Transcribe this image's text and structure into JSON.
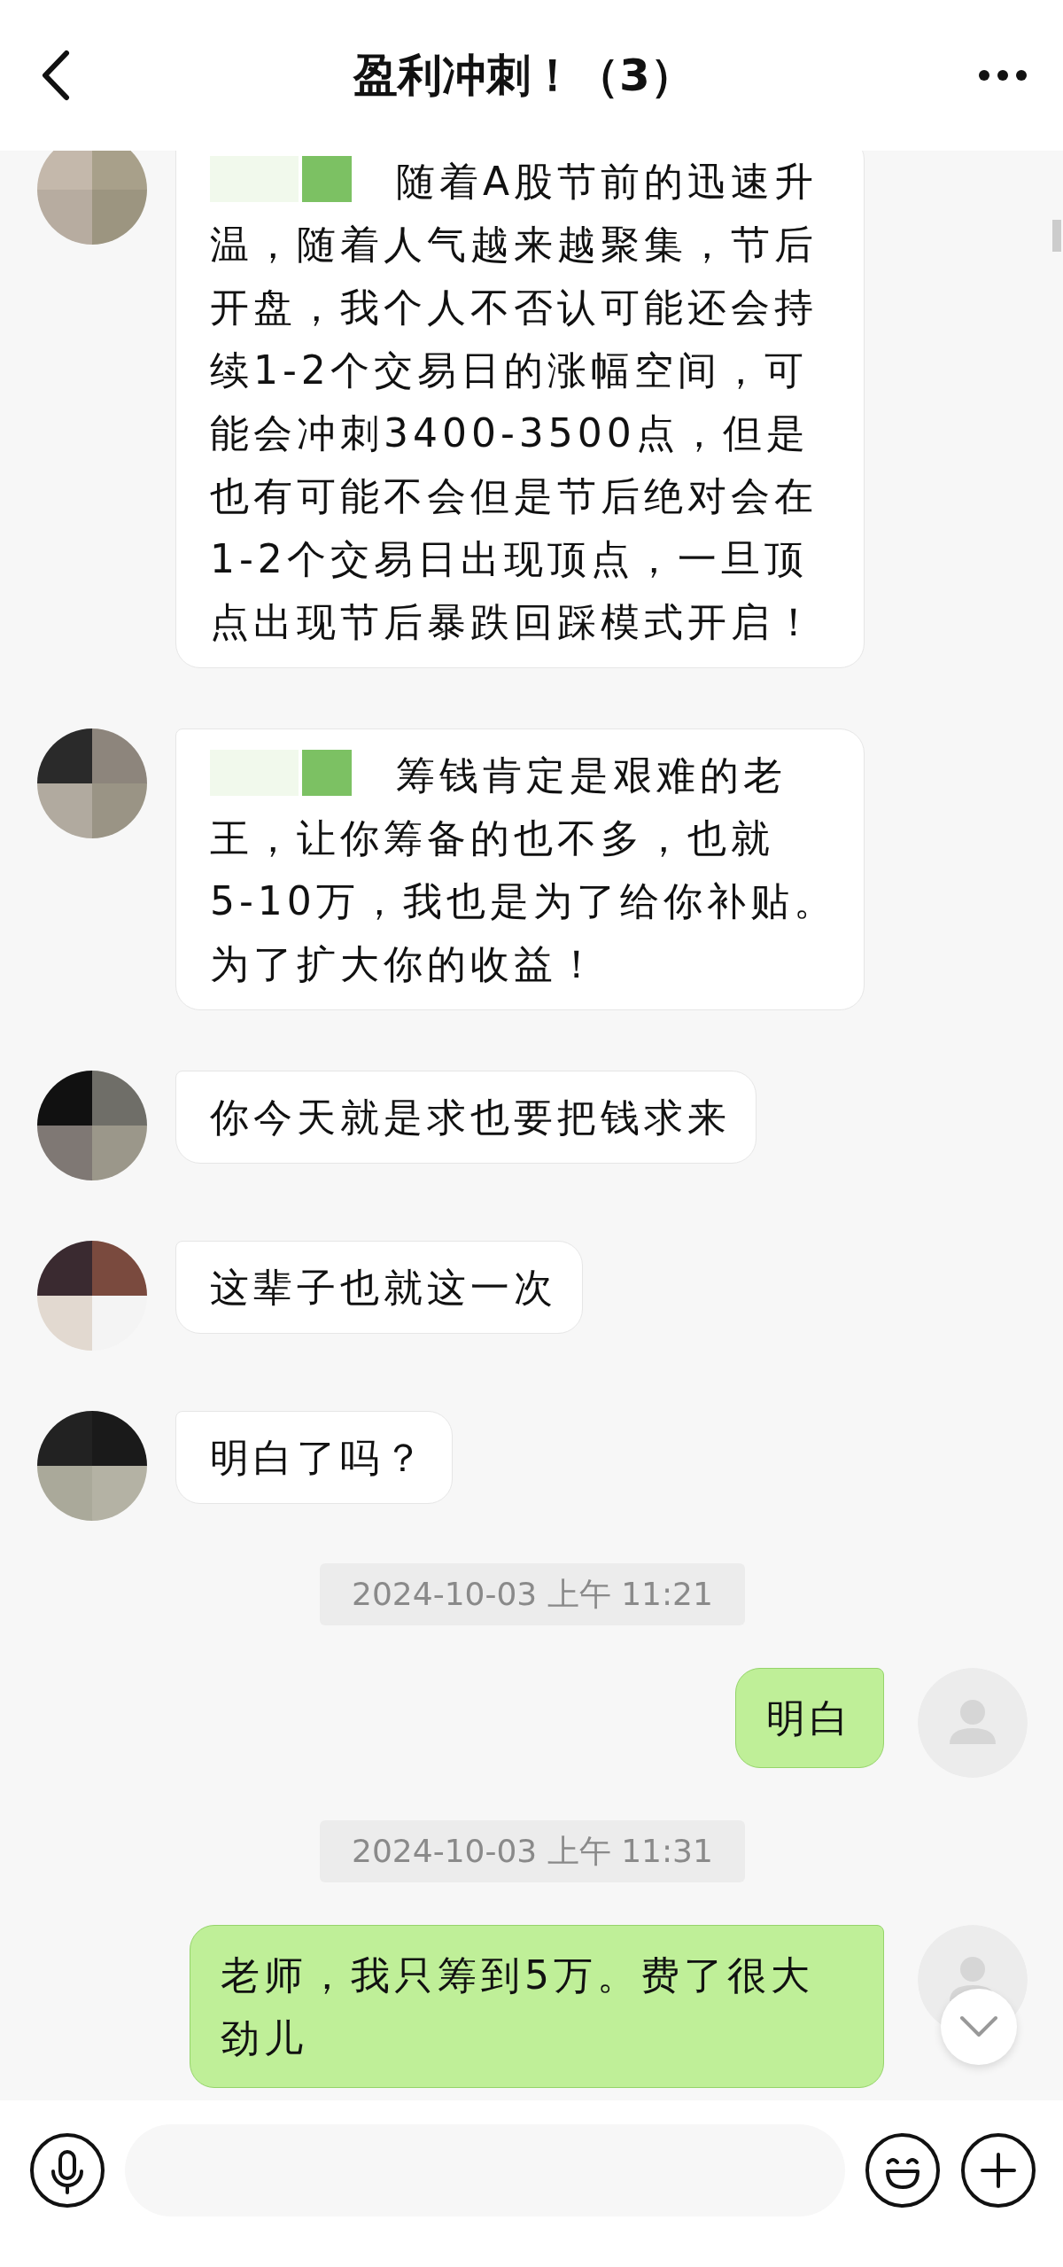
{
  "header": {
    "title": "盈利冲刺！（3）"
  },
  "messages": [
    {
      "kind": "received",
      "redacted_mention": true,
      "text": "随着A股节前的迅速升温，随着人气越来越聚集，节后开盘，我个人不否认可能还会持续1-2个交易日的涨幅空间，可能会冲刺3400-3500点，但是也有可能不会但是节后绝对会在1-2个交易日出现顶点，一旦顶点出现节后暴跌回踩模式开启！"
    },
    {
      "kind": "received",
      "redacted_mention": true,
      "text": "筹钱肯定是艰难的老王，让你筹备的也不多，也就5-10万，我也是为了给你补贴。为了扩大你的收益！"
    },
    {
      "kind": "received",
      "redacted_mention": false,
      "text": "你今天就是求也要把钱求来"
    },
    {
      "kind": "received",
      "redacted_mention": false,
      "text": "这辈子也就这一次"
    },
    {
      "kind": "received",
      "redacted_mention": false,
      "text": "明白了吗？"
    },
    {
      "kind": "timestamp",
      "text": "2024-10-03 上午 11:21"
    },
    {
      "kind": "sent",
      "text": "明白"
    },
    {
      "kind": "timestamp",
      "text": "2024-10-03 上午 11:31"
    },
    {
      "kind": "sent",
      "text": "老师，我只筹到5万。费了很大劲儿"
    }
  ]
}
